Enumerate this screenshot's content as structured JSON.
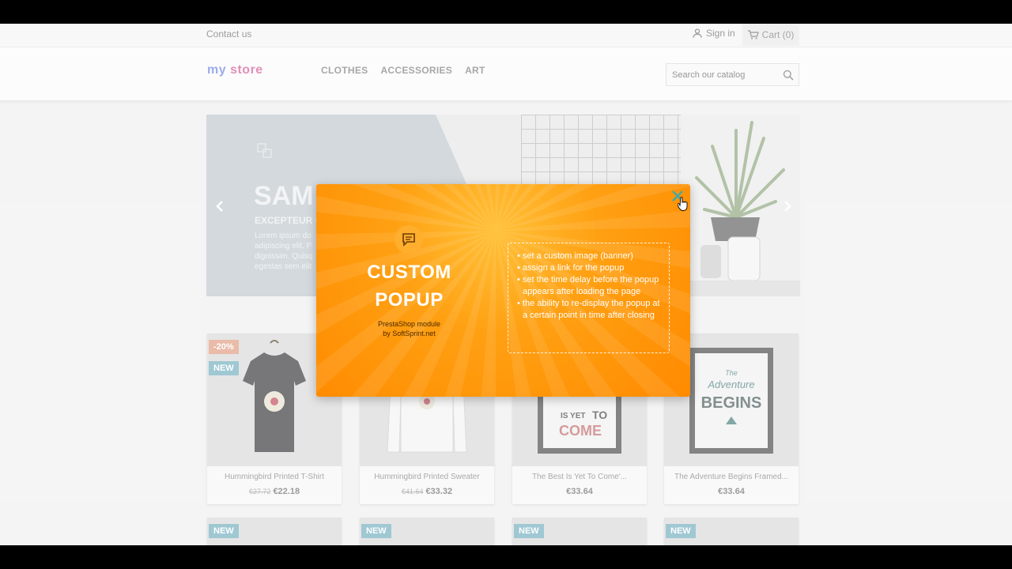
{
  "topbar": {
    "contact": "Contact us",
    "sign_in": "Sign in",
    "cart": "Cart (0)"
  },
  "header": {
    "logo": [
      "my ",
      "store"
    ],
    "nav": [
      "CLOTHES",
      "ACCESSORIES",
      "ART"
    ],
    "search_placeholder": "Search our catalog"
  },
  "slider": {
    "heading": "SAM",
    "subheading": "EXCEPTEUR O",
    "text": "Lorem ipsum do\nadipiscing elit. P\ndignissim. Quisq\negestas sem elit"
  },
  "products": [
    {
      "name": "Hummingbird Printed T-Shirt",
      "old_price": "€27.72",
      "price": "€22.18",
      "badges": [
        "-20%",
        "NEW"
      ]
    },
    {
      "name": "Hummingbird Printed Sweater",
      "old_price": "€41.64",
      "price": "€33.32"
    },
    {
      "name": "The Best Is Yet To Come'...",
      "price": "€33.64",
      "poster_text": [
        "IS YET",
        "TO",
        "COME"
      ]
    },
    {
      "name": "The Adventure Begins Framed...",
      "price": "€33.64",
      "poster_text": [
        "The",
        "Adventure",
        "BEGINS"
      ]
    }
  ],
  "second_row_badges": [
    "NEW",
    "NEW",
    "NEW",
    "NEW"
  ],
  "popup": {
    "title_line1": "CUSTOM",
    "title_line2": "POPUP",
    "subtitle_line1": "PrestaShop module",
    "subtitle_line2": "by SoftSprint.net",
    "features": [
      "set a custom image (banner)",
      "assign a link for the popup",
      "set the time delay before the popup appears after loading the page",
      "the ability to re-display the popup at a certain point in time after closing"
    ]
  },
  "colors": {
    "popup_orange": "#ff9a0a",
    "badge_new": "#7fb6c4",
    "badge_discount": "#e2a58b",
    "close_icon": "#4aa8a0"
  }
}
